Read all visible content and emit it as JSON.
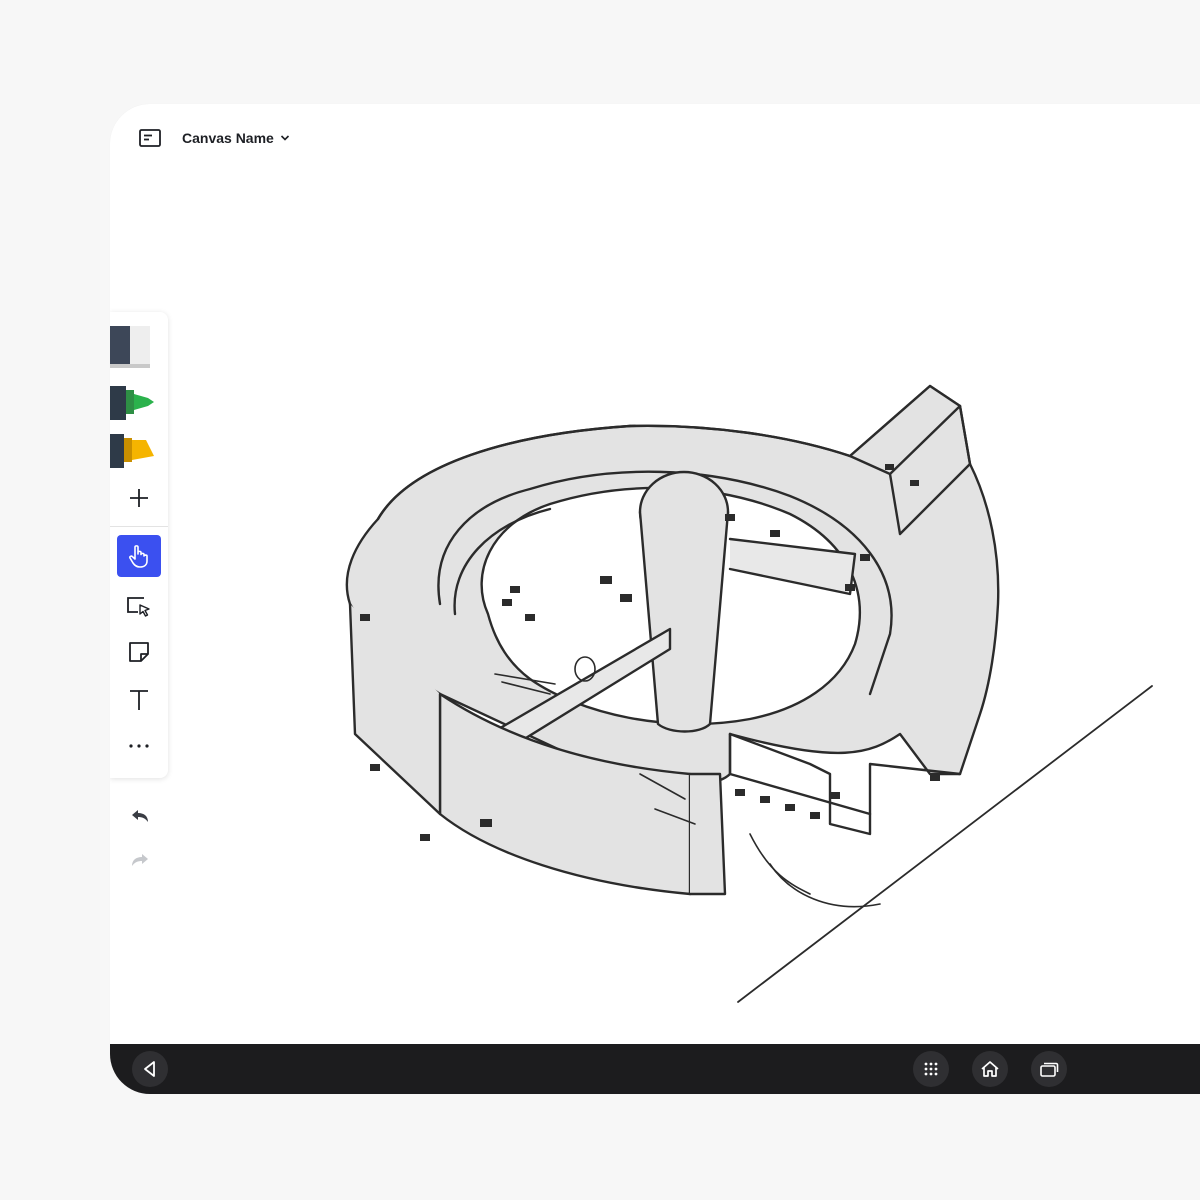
{
  "header": {
    "board_icon": "board-icon",
    "canvas_name": "Canvas Name",
    "dropdown_icon": "chevron-down-icon"
  },
  "toolbar": {
    "tools": [
      {
        "name": "eraser",
        "icon": "eraser-icon"
      },
      {
        "name": "green-marker",
        "icon": "marker-icon",
        "color": "#2bb24c"
      },
      {
        "name": "yellow-highlighter",
        "icon": "highlighter-icon",
        "color": "#f5b400"
      },
      {
        "name": "add",
        "icon": "plus-icon"
      },
      {
        "name": "pan",
        "icon": "hand-pointer-icon",
        "active": true
      },
      {
        "name": "select",
        "icon": "select-icon"
      },
      {
        "name": "sticky-note",
        "icon": "sticky-note-icon"
      },
      {
        "name": "text",
        "icon": "text-icon"
      },
      {
        "name": "more",
        "icon": "more-icon"
      }
    ],
    "accent": "#3b50f0"
  },
  "history": {
    "undo_icon": "undo-icon",
    "redo_icon": "redo-icon"
  },
  "navbar": {
    "back_icon": "back-icon",
    "apps_icon": "apps-grid-icon",
    "home_icon": "home-icon",
    "recents_icon": "recents-icon"
  }
}
